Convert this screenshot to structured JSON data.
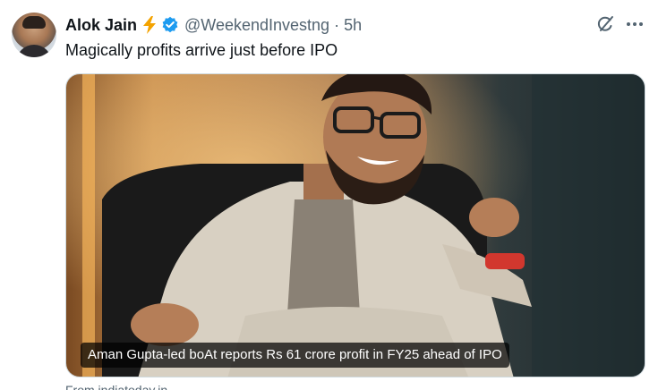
{
  "author": {
    "name": "Alok Jain",
    "handle": "@WeekendInvestng",
    "time": "5h",
    "separator": "·"
  },
  "icons": {
    "bolt": "lightning-bolt-icon",
    "verified": "verified-badge-icon",
    "grok": "grok-icon",
    "more": "more-icon"
  },
  "colors": {
    "verified": "#1d9bf0",
    "bolt": "#f4a300",
    "secondary_text": "#536471"
  },
  "tweet": {
    "text": "Magically profits arrive just before IPO"
  },
  "media": {
    "caption": "Aman Gupta-led boAt reports Rs 61 crore profit in FY25 ahead of IPO"
  },
  "footer": {
    "partial_text": "From indiatoday.in"
  }
}
